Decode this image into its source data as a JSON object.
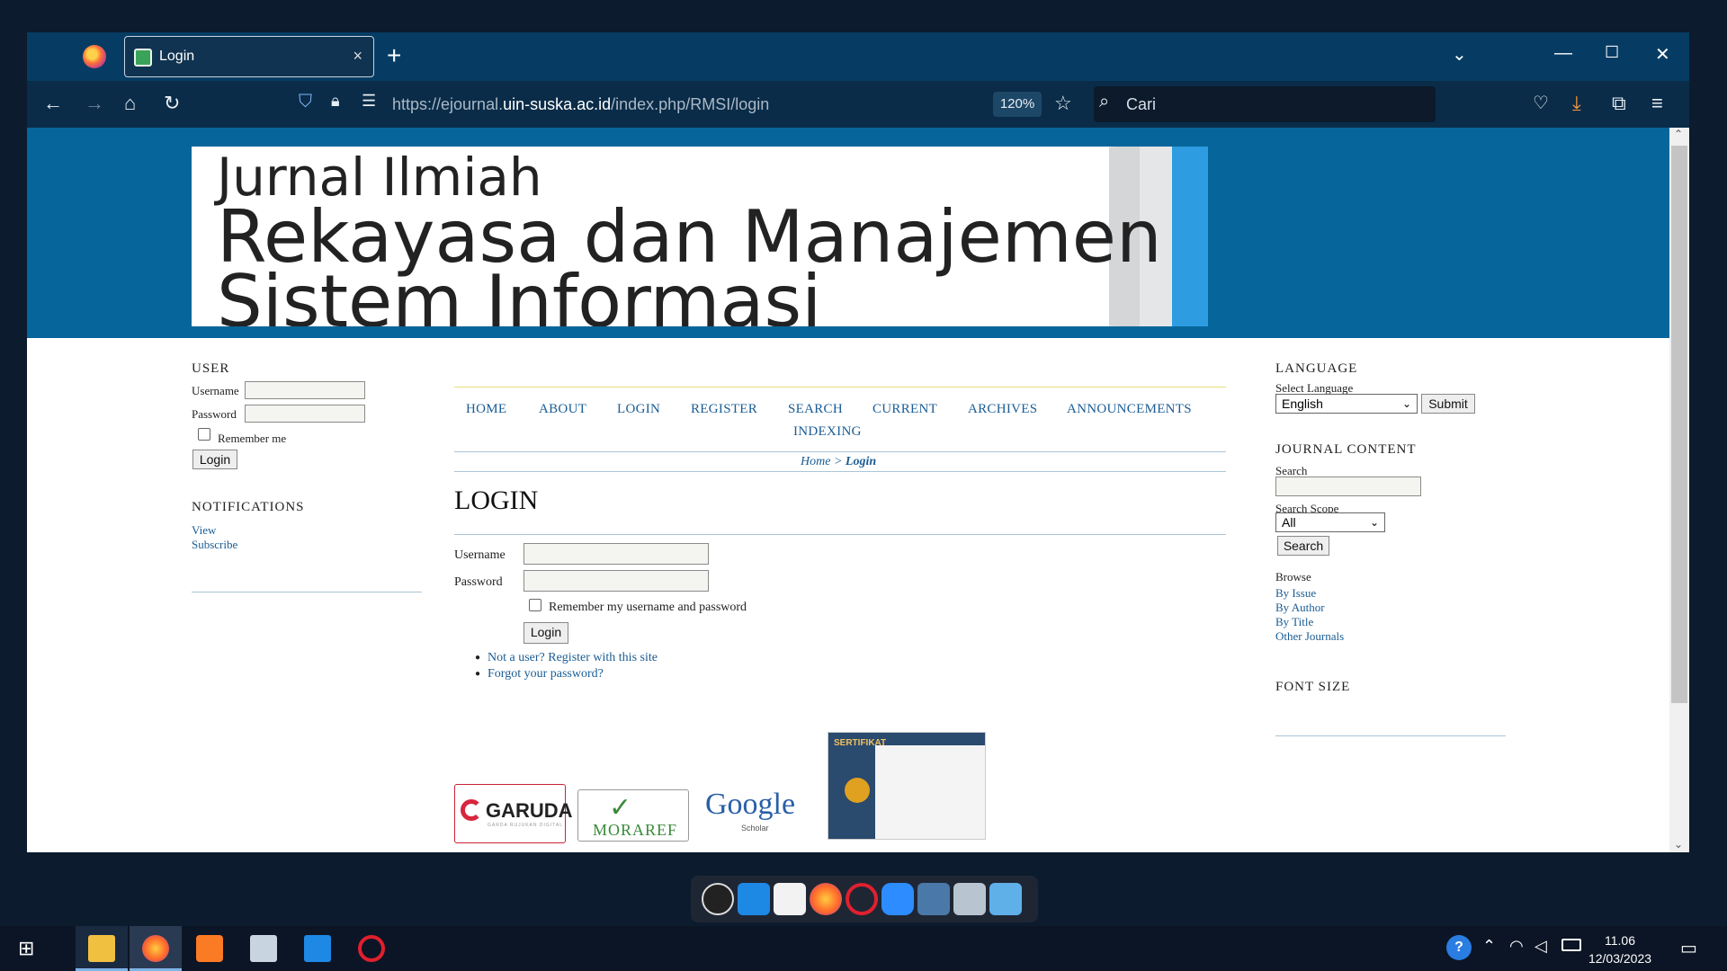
{
  "browser": {
    "tab_title": "Login",
    "url_prefix": "https://ejournal.",
    "url_domain": "uin-suska.ac.id",
    "url_path": "/index.php/RMSI/login",
    "zoom": "120%",
    "search_placeholder": "Cari",
    "close_tab": "×",
    "new_tab": "+"
  },
  "banner": {
    "line1": "Jurnal Ilmiah",
    "line2": "Rekayasa dan Manajemen",
    "line3": "Sistem Informasi"
  },
  "left_sidebar": {
    "user_title": "USER",
    "username_label": "Username",
    "password_label": "Password",
    "remember_label": "Remember me",
    "login_button": "Login",
    "notifications_title": "NOTIFICATIONS",
    "view_link": "View",
    "subscribe_link": "Subscribe"
  },
  "menu": {
    "items": [
      "HOME",
      "ABOUT",
      "LOGIN",
      "REGISTER",
      "SEARCH",
      "CURRENT",
      "ARCHIVES",
      "ANNOUNCEMENTS",
      "INDEXING"
    ]
  },
  "breadcrumb": {
    "home": "Home",
    "sep": ">",
    "current": "Login"
  },
  "main": {
    "heading": "LOGIN",
    "username_label": "Username",
    "password_label": "Password",
    "remember_label": "Remember my username and password",
    "login_button": "Login",
    "register_link": "Not a user? Register with this site",
    "forgot_link": "Forgot your password?"
  },
  "logos": {
    "garuda": "GARUDA",
    "garuda_sub": "GARDA RUJUKAN DIGITAL",
    "moraref": "MORAREF",
    "google": "Google",
    "scholar": "Scholar",
    "sertifikat": "SERTIFIKAT"
  },
  "right_sidebar": {
    "language_title": "LANGUAGE",
    "select_language_label": "Select Language",
    "language_value": "English",
    "submit_button": "Submit",
    "journal_content_title": "JOURNAL CONTENT",
    "search_label": "Search",
    "search_scope_label": "Search Scope",
    "scope_value": "All",
    "search_button": "Search",
    "browse_label": "Browse",
    "browse_links": [
      "By Issue",
      "By Author",
      "By Title",
      "Other Journals"
    ],
    "font_size_title": "FONT SIZE"
  },
  "taskbar": {
    "time": "11.06",
    "date": "12/03/2023"
  }
}
